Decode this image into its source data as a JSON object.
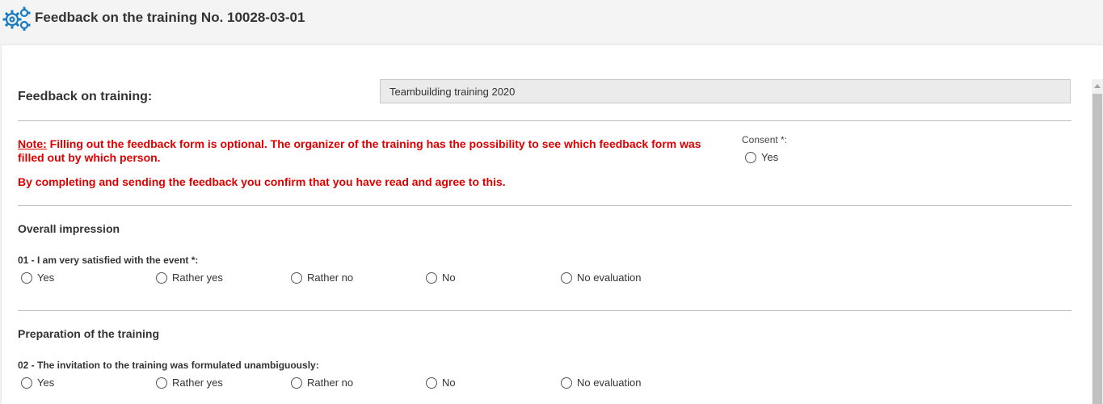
{
  "header": {
    "title": "Feedback on the training No. 10028-03-01",
    "icon": "gears-icon"
  },
  "form": {
    "training_label": "Feedback on training:",
    "training_value": "Teambuilding training 2020",
    "note_key": "Note:",
    "note_text": " Filling out the feedback form is optional. The organizer of the training has the possibility to see which feedback form was filled out by which person.",
    "confirm_text": "By completing and sending the feedback you confirm that you have read and agree to this.",
    "consent_label": "Consent *:",
    "consent_option": "Yes"
  },
  "sections": [
    {
      "title": "Overall impression",
      "question": "01 - I am very satisfied with the event *:",
      "options": [
        "Yes",
        "Rather yes",
        "Rather no",
        "No",
        "No evaluation"
      ]
    },
    {
      "title": "Preparation of the training",
      "question": "02 - The invitation to the training was formulated unambiguously:",
      "options": [
        "Yes",
        "Rather yes",
        "Rather no",
        "No",
        "No evaluation"
      ]
    }
  ],
  "colors": {
    "accent": "#1a7bbf",
    "warning": "#e00000"
  }
}
